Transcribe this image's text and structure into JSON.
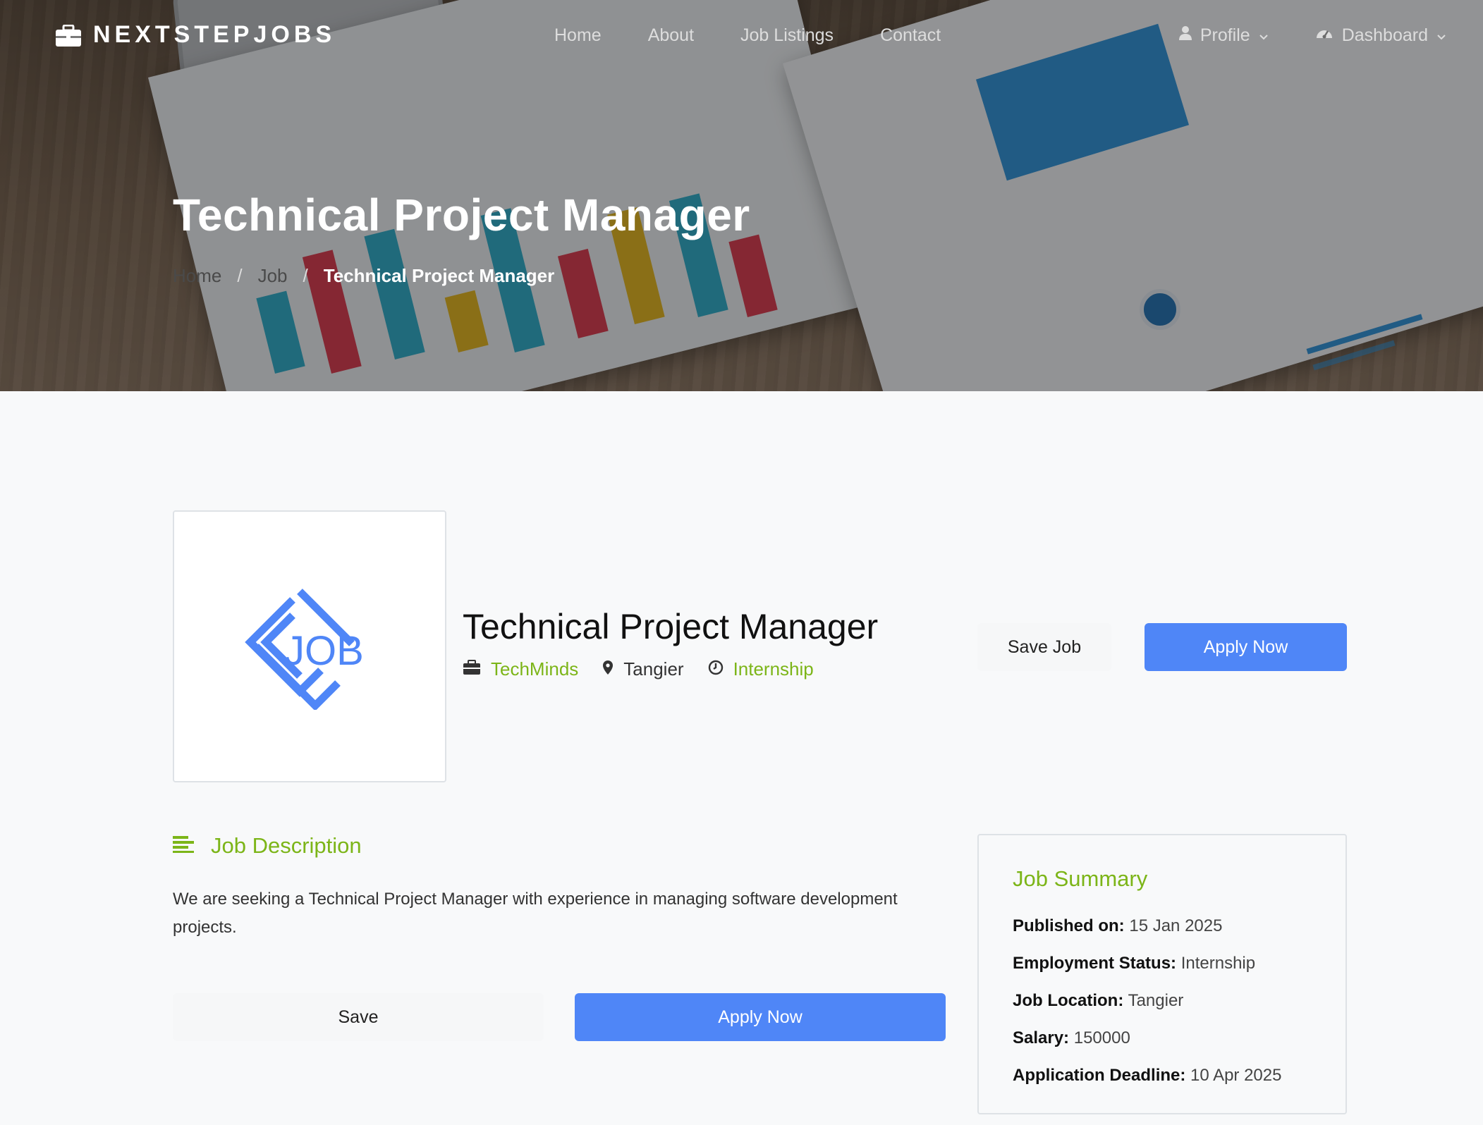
{
  "brand": {
    "name": "NEXTSTEPJOBS",
    "icon": "briefcase-icon"
  },
  "nav": {
    "links": [
      "Home",
      "About",
      "Job Listings",
      "Contact"
    ],
    "profile_label": "Profile",
    "dashboard_label": "Dashboard"
  },
  "hero": {
    "title": "Technical Project Manager",
    "breadcrumb": {
      "home": "Home",
      "job": "Job",
      "current": "Technical Project Manager"
    }
  },
  "job": {
    "logo_text": "JOB",
    "title": "Technical Project Manager",
    "company": "TechMinds",
    "location": "Tangier",
    "type": "Internship",
    "save_label": "Save Job",
    "apply_label": "Apply Now"
  },
  "description": {
    "heading": "Job Description",
    "text": "We are seeking a Technical Project Manager with experience in managing software development projects.",
    "save_label": "Save",
    "apply_label": "Apply Now"
  },
  "summary": {
    "heading": "Job Summary",
    "published_label": "Published on:",
    "published_value": "15 Jan 2025",
    "status_label": "Employment Status:",
    "status_value": "Internship",
    "location_label": "Job Location:",
    "location_value": "Tangier",
    "salary_label": "Salary:",
    "salary_value": "150000",
    "deadline_label": "Application Deadline:",
    "deadline_value": "10 Apr 2025"
  },
  "colors": {
    "accent_green": "#7cb518",
    "primary_blue": "#4f86f7"
  }
}
